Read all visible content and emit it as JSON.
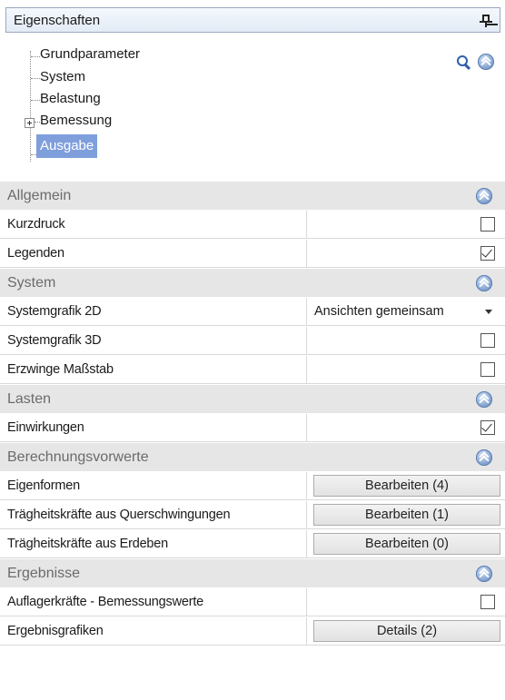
{
  "header": {
    "title": "Eigenschaften",
    "pin_icon": "pin-icon"
  },
  "tree": {
    "items": [
      {
        "label": "Grundparameter"
      },
      {
        "label": "System"
      },
      {
        "label": "Belastung"
      },
      {
        "label": "Bemessung"
      },
      {
        "label": "Ausgabe"
      }
    ],
    "selected": "Ausgabe",
    "selected_color": "#7f9fdc"
  },
  "groups": {
    "allgemein": {
      "label": "Allgemein",
      "kurzdruck": {
        "label": "Kurzdruck",
        "checked": false
      },
      "legenden": {
        "label": "Legenden",
        "checked": true
      }
    },
    "system": {
      "label": "System",
      "systemgrafik_2d": {
        "label": "Systemgrafik 2D",
        "value": "Ansichten gemeinsam"
      },
      "systemgrafik_3d": {
        "label": "Systemgrafik 3D",
        "checked": false
      },
      "massstab": {
        "label": "Erzwinge Maßstab",
        "checked": false
      }
    },
    "lasten": {
      "label": "Lasten",
      "einwirkungen": {
        "label": "Einwirkungen",
        "checked": true
      }
    },
    "berechnung": {
      "label": "Berechnungsvorwerte",
      "eigenformen": {
        "label": "Eigenformen",
        "button": "Bearbeiten (4)"
      },
      "querschwingungen": {
        "label": "Trägheitskräfte aus Querschwingungen",
        "button": "Bearbeiten (1)"
      },
      "erdbeben": {
        "label": "Trägheitskräfte aus Erdeben",
        "button": "Bearbeiten (0)"
      }
    },
    "ergebnisse": {
      "label": "Ergebnisse",
      "auflagerkraefte": {
        "label": "Auflagerkräfte - Bemessungswerte",
        "checked": false
      },
      "ergebnisgrafiken": {
        "label": "Ergebnisgrafiken",
        "button": "Details (2)"
      }
    }
  }
}
